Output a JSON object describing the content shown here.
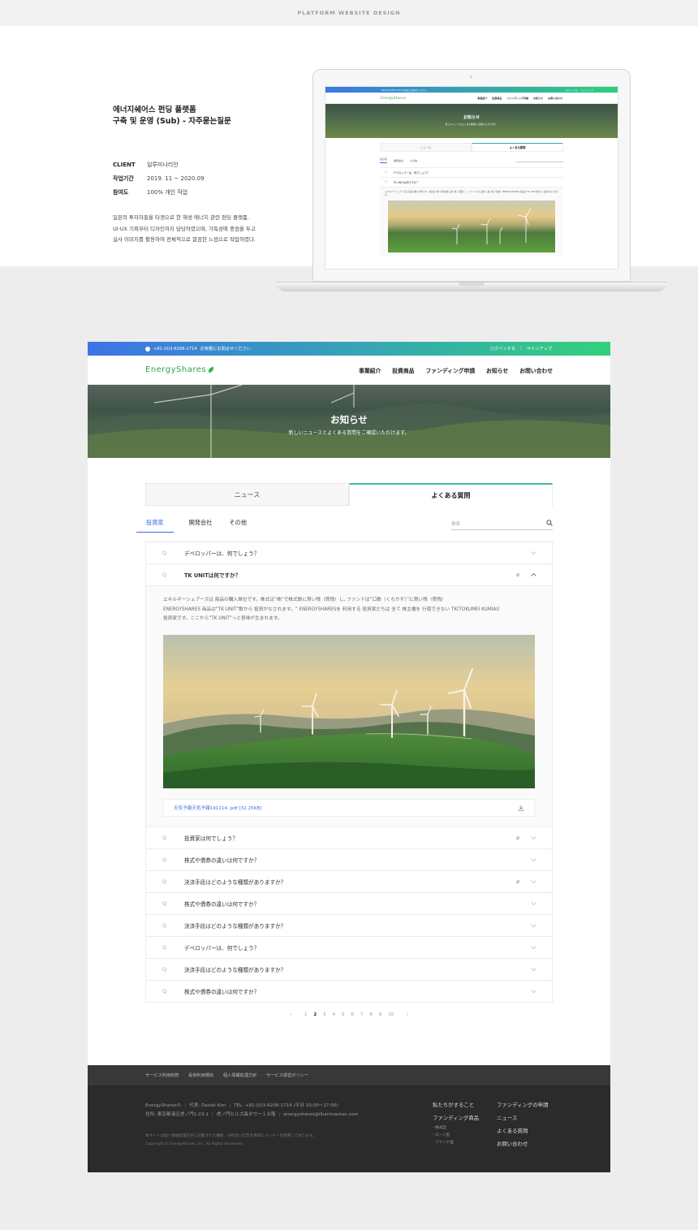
{
  "showcase": {
    "caption": "PLATFORM WEBSITE DESIGN",
    "title_line1": "에너지쉐어스 펀딩 플랫폼",
    "title_line2": "구축 및 운영 (Sub) - 자주묻는질문",
    "meta": [
      {
        "key": "CLIENT",
        "value": "일루미나리안"
      },
      {
        "key": "작업기간",
        "value": "2019. 11 ~ 2020.09"
      },
      {
        "key": "참여도",
        "value": "100% 개인 작업"
      }
    ],
    "desc_line1": "일본의 투자자들을 타겟으로 한 재생 에너지 관련 펀딩 플랫폼.",
    "desc_line2": "UI·UX 기획부터 디자인까지 담당하였으며, 가독성에 중점을 두고",
    "desc_line3": "실사 이미지를 활용하여 전체적으로 깔끔한 느낌으로 작업하였다."
  },
  "topbar": {
    "phone": "+81-(0)3-6206-1714",
    "phone_note": "お気軽にお問合せください",
    "login": "ログインする",
    "signup": "サインアップ"
  },
  "header": {
    "logo": "EnergyShares",
    "nav": [
      "事業紹介",
      "投資商品",
      "ファンディング申請",
      "お知らせ",
      "お問い合わせ"
    ]
  },
  "hero": {
    "title": "お知らせ",
    "subtitle": "新しいニュースとよくある質問をご確認いただけます。"
  },
  "tabs": {
    "news": "ニュース",
    "faq": "よくある質問"
  },
  "subtabs": [
    "投資家",
    "開発会社",
    "その他"
  ],
  "search": {
    "placeholder": "検索"
  },
  "faq": {
    "first": "デベロッパーは、何でしょう？",
    "open_question": "TK UNITは何ですか？",
    "answer_line1": "エネルギーシェアーズは 商品の購入単位です。株式は“株”で株式数に買い残（買残）し, ファンドは“口数（くちかず）”に買い残（買残）",
    "answer_line2": "ENERGYSHARES 商品は“TK UNIT”数から 投資がなされます。“ ENERGYSHARESを 利用する 投資家だちは 全て 株主権を 行使できない TK(TOKUMEI KUMIAI)",
    "answer_line3": "投資家です。ここから“TK UNIT”っと意味が生まれます。",
    "attachment": "天気予報天気予報191114. pdf [32.25KB]",
    "rest": [
      {
        "q": "投資家は何でしょう？",
        "clip": true
      },
      {
        "q": "株式や債券の違いは何ですか？",
        "clip": false
      },
      {
        "q": "決済手段はどのような種類がありますか？",
        "clip": true
      },
      {
        "q": "株式や債券の違いは何ですか？",
        "clip": false
      },
      {
        "q": "決済手段はどのような種類がありますか？",
        "clip": false
      },
      {
        "q": "デベロッパーは、何でしょう？",
        "clip": false
      },
      {
        "q": "決済手段はどのような種類がありますか？",
        "clip": false
      },
      {
        "q": "株式や債券の違いは何ですか？",
        "clip": false
      }
    ],
    "qmark": "Q"
  },
  "pagination": {
    "pages": [
      "1",
      "2",
      "3",
      "4",
      "5",
      "6",
      "7",
      "8",
      "9",
      "10"
    ],
    "current": "2",
    "prev": "‹",
    "next": "›"
  },
  "footer": {
    "links": [
      "サービス利用約款",
      "投資利用規約",
      "個人情報処理方針",
      "サービス運営ポリシー"
    ],
    "info_line1_a": "EnergyShares©",
    "info_line1_b": "代表: Daniel Kim",
    "info_line1_c": "TEL: +81-(0)3-6206-1714 (平日 10:00～17:00)",
    "info_line2_a": "住所: 東京都港区虎ノ門1-23-1",
    "info_line2_b": "虎ノ門ヒルズ森タワー１８階",
    "info_line2_c": "energyshares@illuminarean.com",
    "note": "本サイトは個人情報処理方針に記載された機能、分析及び広告を目的にクッキーを使用しております。",
    "copyright": "Copyright © EnergyShares, Inc. All Rights Reserved.",
    "col1_a": "私たちがすること",
    "col1_b": "ファンディング商品",
    "col1_items": [
      "- 株式型",
      "- ローン型",
      "- ファンド型"
    ],
    "col2": [
      "ファンディングの申請",
      "ニュース",
      "よくある質問",
      "お問い合わせ"
    ]
  },
  "mock": {
    "topbar": "+81-(0)3-6206-1714 お気軽にお問合せください",
    "topbar_right": "ログインする ・ サインアップ",
    "logo": "EnergyShares",
    "nav": [
      "事業紹介",
      "投資商品",
      "ファンディング申請",
      "お知らせ",
      "お問い合わせ"
    ],
    "hero_title": "お知らせ",
    "hero_sub": "新しいニュースとよくある質問をご確認いただけます。",
    "tab_news": "ニュース",
    "tab_faq": "よくある質問",
    "sub": [
      "投資家",
      "開発会社",
      "その他"
    ],
    "q1": "デベロッパーは、何でしょう？",
    "q2": "TK UNITは何ですか？",
    "ans": "エネルギーシェアーズは 商品の購入単位です。株式は“株”で株式数に買い残（買残）し, ファンドは“口数”に買い残（買残）ENERGYSHARES 商品は“TK UNIT”数から 投資がなされます。"
  },
  "colors": {
    "accent": "#3a6fdc",
    "brand": "#2fa34f",
    "gradient_start": "#3d74e6",
    "gradient_end": "#33d07c"
  }
}
